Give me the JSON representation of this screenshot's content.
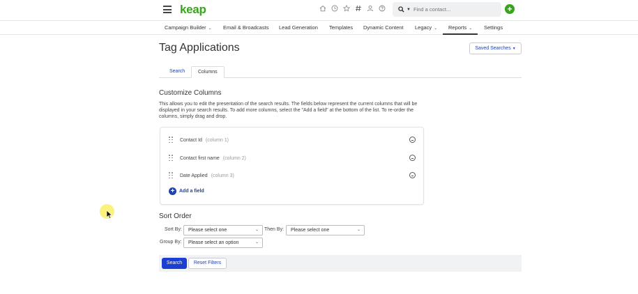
{
  "header": {
    "logo": "keap",
    "search_placeholder": "Find a contact...",
    "icons": [
      "home-icon",
      "clock-icon",
      "star-icon",
      "hash-icon",
      "person-icon",
      "help-icon"
    ],
    "brand_color": "#38a31c"
  },
  "nav": {
    "items": [
      {
        "label": "Campaign Builder",
        "has_dropdown": true
      },
      {
        "label": "Email & Broadcasts",
        "has_dropdown": false
      },
      {
        "label": "Lead Generation",
        "has_dropdown": false
      },
      {
        "label": "Templates",
        "has_dropdown": false
      },
      {
        "label": "Dynamic Content",
        "has_dropdown": false
      },
      {
        "label": "Legacy",
        "has_dropdown": true
      },
      {
        "label": "Reports",
        "has_dropdown": true,
        "active": true
      },
      {
        "label": "Settings",
        "has_dropdown": false
      }
    ]
  },
  "page": {
    "title": "Tag Applications",
    "saved_searches_label": "Saved Searches"
  },
  "tabs": [
    {
      "label": "Search",
      "active": false
    },
    {
      "label": "Columns",
      "active": true
    }
  ],
  "customize": {
    "title": "Customize Columns",
    "description": "This allows you to edit the presentation of the search results. The fields below represent the current columns that will be displayed in your search results. To add more columns, select the \"Add a field\" at the bottom of the list. To re-order the columns, simply drag and drop.",
    "columns": [
      {
        "name": "Contact Id",
        "position": "(column 1)"
      },
      {
        "name": "Contact first name",
        "position": "(column 2)"
      },
      {
        "name": "Date Applied",
        "position": "(column 3)"
      }
    ],
    "add_field_label": "Add a field"
  },
  "sort": {
    "title": "Sort Order",
    "sort_by_label": "Sort By:",
    "sort_by_value": "Please select one",
    "then_by_label": "Then By:",
    "then_by_value": "Please select one",
    "group_by_label": "Group By:",
    "group_by_value": "Please select an option"
  },
  "actions": {
    "search_label": "Search",
    "reset_label": "Reset Filters",
    "primary_color": "#1a3fd1"
  }
}
